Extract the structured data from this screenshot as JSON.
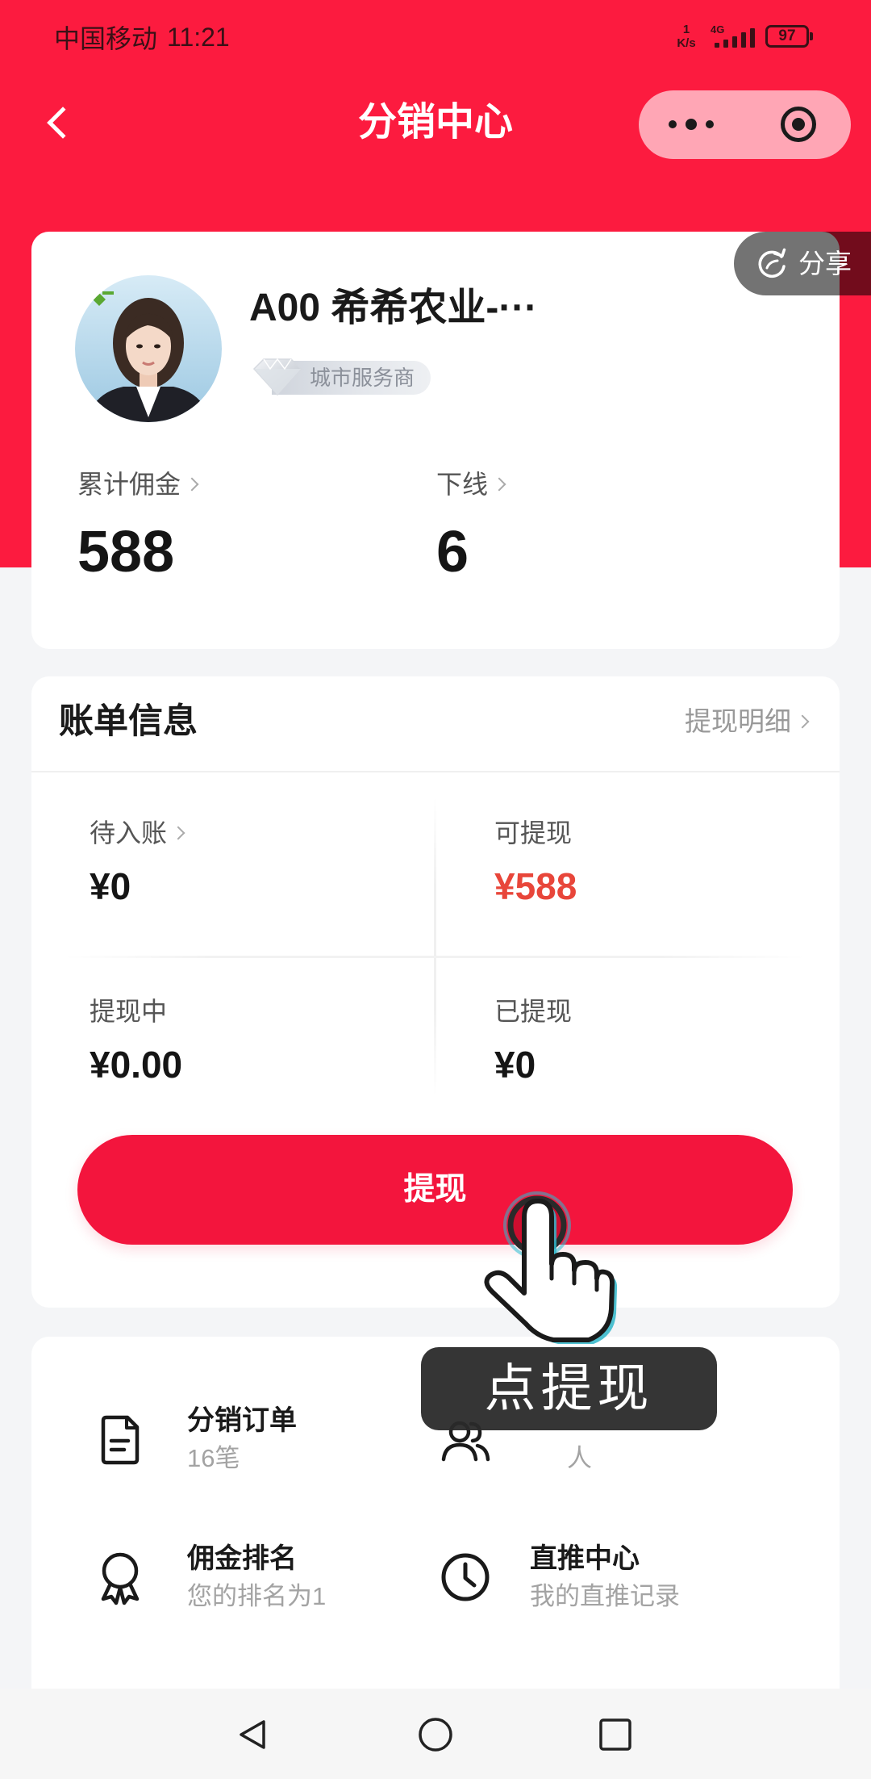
{
  "status_bar": {
    "carrier": "中国移动",
    "time": "11:21",
    "net_speed": "1",
    "net_speed_unit": "K/s",
    "network_type": "4G",
    "battery_level": "97"
  },
  "header": {
    "title": "分销中心",
    "back_icon": "back-arrow-icon",
    "more_icon": "more-dots-icon",
    "close_icon": "target-circle-icon"
  },
  "profile": {
    "share_label": "分享",
    "share_icon": "share-refresh-icon",
    "name": "A00 希希农业-···",
    "badge": "城市服务商",
    "badge_icon": "diamond-icon",
    "stats": [
      {
        "label": "累计佣金",
        "value": "588"
      },
      {
        "label": "下线",
        "value": "6"
      }
    ]
  },
  "bill": {
    "title": "账单信息",
    "detail_link": "提现明细",
    "items": [
      {
        "label": "待入账",
        "value": "¥0"
      },
      {
        "label": "可提现",
        "value": "¥588"
      },
      {
        "label": "提现中",
        "value": "¥0.00"
      },
      {
        "label": "已提现",
        "value": "¥0"
      }
    ],
    "withdraw_button": "提现"
  },
  "guide_overlay": {
    "tooltip": "点提现",
    "pointer_icon": "hand-pointer-icon"
  },
  "menu": {
    "items": [
      {
        "title": "分销订单",
        "subtitle": "16笔",
        "icon": "document-icon"
      },
      {
        "subtitle": "人",
        "icon": "people-icon"
      },
      {
        "title": "佣金排名",
        "subtitle": "您的排名为1",
        "icon": "award-icon"
      },
      {
        "title": "直推中心",
        "subtitle": "我的直推记录",
        "icon": "clock-icon"
      }
    ]
  },
  "nav_bar": {
    "icons": [
      "back-triangle-icon",
      "home-circle-icon",
      "recents-square-icon"
    ]
  },
  "colors": {
    "brand_red": "#fc1b3f",
    "button_red": "#f3153d",
    "amount_red": "#e8463a",
    "page_bg": "#f4f5f7",
    "capsule_bg": "#ffa6b5",
    "text_primary": "#1a1a1a",
    "text_secondary": "#999999"
  }
}
